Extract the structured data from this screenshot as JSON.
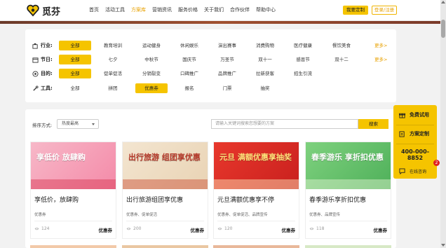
{
  "brand": {
    "name": "觅芬"
  },
  "nav": [
    {
      "label": "首页",
      "active": false
    },
    {
      "label": "活动工具",
      "active": false
    },
    {
      "label": "方案库",
      "active": true
    },
    {
      "label": "营销资讯",
      "active": false
    },
    {
      "label": "服务价格",
      "active": false
    },
    {
      "label": "关于我们",
      "active": false
    },
    {
      "label": "合作伙伴",
      "active": false
    },
    {
      "label": "帮助中心",
      "active": false
    }
  ],
  "header": {
    "custom_label": "我要定制",
    "login_label": "登录/注册"
  },
  "filters": [
    {
      "label": "行业:",
      "icon": "industry-icon",
      "options": [
        "全部",
        "教育培训",
        "运动健身",
        "休闲娱乐",
        "演出赛事",
        "消费购物",
        "医疗健康",
        "餐饮美食"
      ],
      "selected": 0,
      "more": "更多>"
    },
    {
      "label": "节日:",
      "icon": "calendar-icon",
      "options": [
        "全部",
        "七夕",
        "中秋节",
        "国庆节",
        "万圣节",
        "双十一",
        "感恩节",
        "双十二"
      ],
      "selected": 0,
      "more": "更多>"
    },
    {
      "label": "目的:",
      "icon": "target-icon",
      "options": [
        "全部",
        "促单促活",
        "分销裂变",
        "口碑推广",
        "品牌推广",
        "拉新获客",
        "招生引流"
      ],
      "selected": 0,
      "more": ""
    },
    {
      "label": "工具:",
      "icon": "tools-icon",
      "options": [
        "全部",
        "拼团",
        "优惠券",
        "报名",
        "门票",
        "抽奖"
      ],
      "selected": 2,
      "more": ""
    }
  ],
  "list": {
    "sort_label": "排序方式:",
    "sort_value": "热度最高",
    "search_placeholder": "请输入关键词搜索您想要的方案",
    "search_button": "搜索"
  },
  "cards": [
    {
      "title": "享低价，放肆购",
      "tags": "优惠券",
      "views": "124",
      "type": "优惠券",
      "banner_text": "享低价 放肆购",
      "theme": "shopping"
    },
    {
      "title": "出行旅游组团享优惠",
      "tags": "优惠券、促单促活",
      "views": "200",
      "type": "优惠券",
      "banner_text": "出行旅游 组团享优惠",
      "theme": "travel"
    },
    {
      "title": "元旦满额优惠享不停",
      "tags": "优惠券、促单促活、品牌宣传",
      "views": "120",
      "type": "优惠券",
      "banner_text": "元旦 满额优惠享抽奖",
      "theme": "newyear"
    },
    {
      "title": "春季游乐享折扣优惠",
      "tags": "优惠券、品牌宣传",
      "views": "118",
      "type": "优惠券",
      "banner_text": "春季游乐 享折扣优惠",
      "theme": "spring"
    }
  ],
  "float": {
    "trial": "免费试用",
    "plan": "方案定制",
    "phone": "400-000-8852",
    "chat": "在线咨询",
    "chat_badge": "2"
  },
  "colors": {
    "accent": "#f5c400",
    "accent_text": "#e8a100"
  }
}
